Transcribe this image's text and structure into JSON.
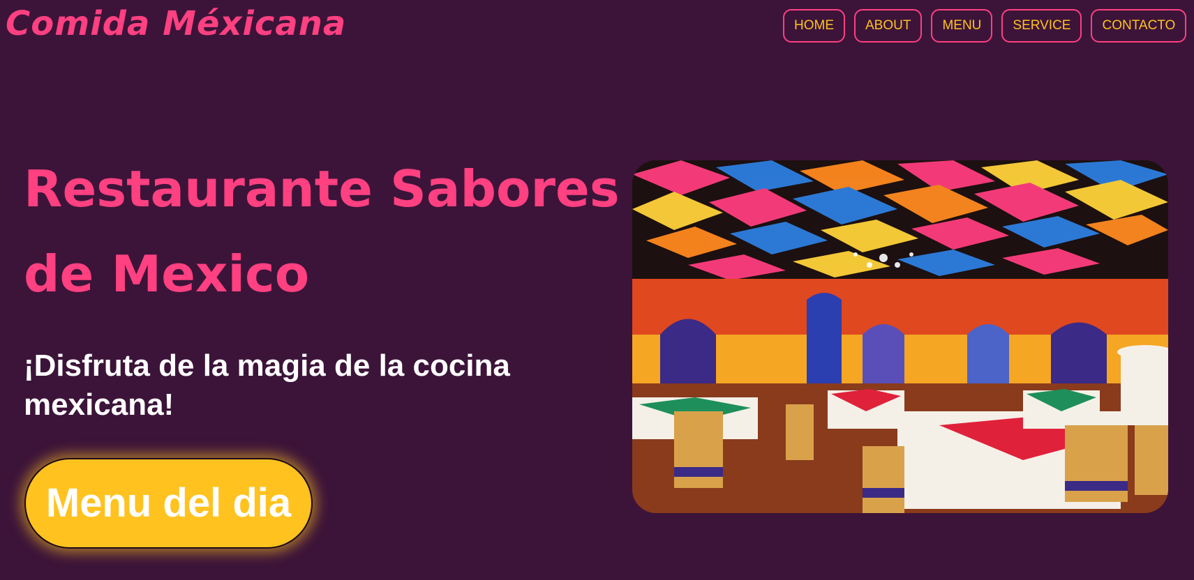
{
  "header": {
    "brand": "Comida Méxicana",
    "nav": [
      "HOME",
      "ABOUT",
      "MENU",
      "SERVICE",
      "CONTACTO"
    ]
  },
  "hero": {
    "title": "Restaurante Sabores de Mexico",
    "subtitle": "¡Disfruta de la magia de la cocina mexicana!",
    "cta_label": "Menu del dia"
  },
  "image": {
    "subject": "colorful mexican restaurant dining room with papel picado ceiling"
  },
  "colors": {
    "background": "#3c1439",
    "accent_pink": "#ff4081",
    "accent_yellow": "#ffc21f",
    "text_white": "#ffffff"
  }
}
